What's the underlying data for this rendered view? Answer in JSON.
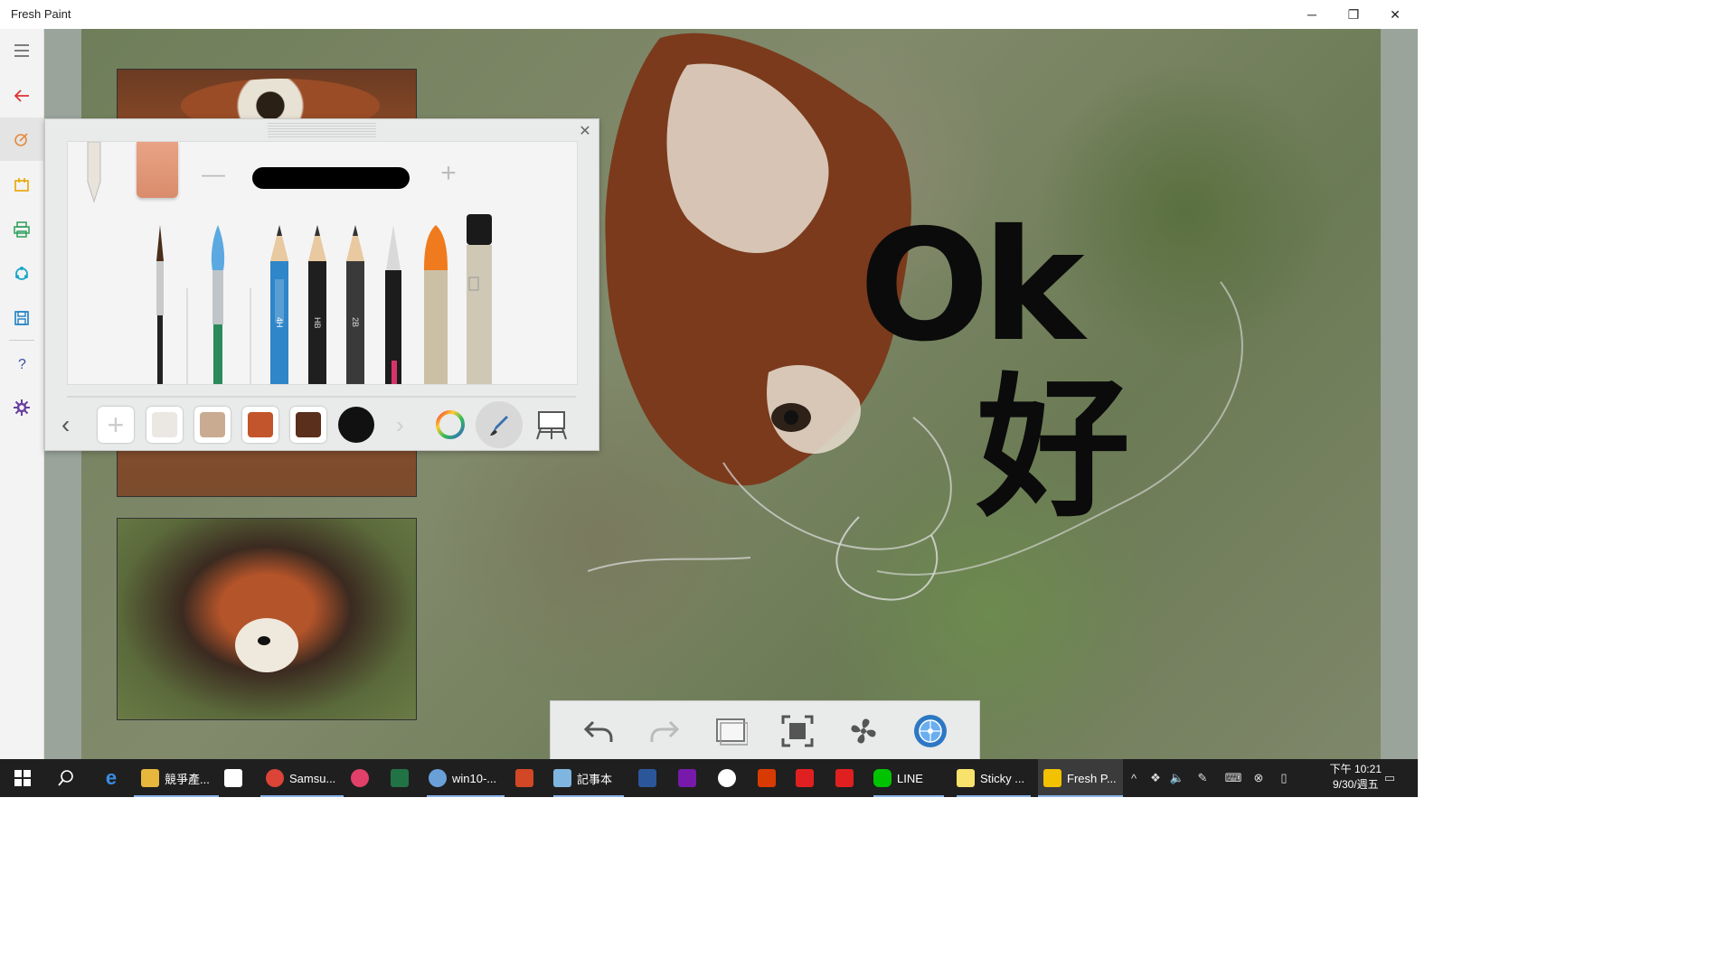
{
  "app": {
    "title": "Fresh Paint"
  },
  "window_controls": {
    "minimize": "─",
    "maximize": "❐",
    "close": "✕"
  },
  "left_rail": {
    "items": [
      {
        "name": "menu-icon"
      },
      {
        "name": "back-arrow-icon"
      },
      {
        "name": "brush-icon"
      },
      {
        "name": "import-icon"
      },
      {
        "name": "print-icon"
      },
      {
        "name": "share-icon"
      },
      {
        "name": "save-icon"
      },
      {
        "name": "help-icon"
      },
      {
        "name": "settings-icon"
      }
    ]
  },
  "canvas": {
    "text_1": "Ok",
    "text_2": "好"
  },
  "tool_panel": {
    "close": "✕",
    "size_minus": "—",
    "size_plus": "+",
    "tools": [
      "brush-fine",
      "brush-flat",
      "pencil-4H",
      "pencil-HB",
      "pencil-2B",
      "pen",
      "crayon",
      "marker"
    ],
    "pencil_labels": [
      "4H",
      "HB",
      "2B"
    ],
    "swatch_colors": [
      "#ebe8e3",
      "#c9ab92",
      "#c2552b",
      "#5a2f1b",
      "#111111"
    ],
    "add_color": "+",
    "prev": "‹",
    "next": "›"
  },
  "bottom_toolbar": {
    "items": [
      "undo-icon",
      "redo-icon",
      "layers-icon",
      "fit-screen-icon",
      "fan-dry-icon",
      "compass-icon"
    ]
  },
  "taskbar": {
    "apps": [
      {
        "label": "競爭產...",
        "color": "#e6b73c"
      },
      {
        "label": "",
        "color": "#ffffff"
      },
      {
        "label": "Samsu...",
        "color": "#db4437"
      },
      {
        "label": "",
        "color": "#e0406a"
      },
      {
        "label": "",
        "color": "#217346"
      },
      {
        "label": "win10-...",
        "color": "#6aa0d8"
      },
      {
        "label": "",
        "color": "#d24726"
      },
      {
        "label": "記事本",
        "color": "#7eb6e0"
      },
      {
        "label": "",
        "color": "#2b579a"
      },
      {
        "label": "",
        "color": "#7719aa"
      },
      {
        "label": "",
        "color": "#ffffff"
      },
      {
        "label": "",
        "color": "#d83b01"
      },
      {
        "label": "",
        "color": "#e02020"
      },
      {
        "label": "",
        "color": "#e02020"
      },
      {
        "label": "LINE",
        "color": "#00c300"
      },
      {
        "label": "Sticky ...",
        "color": "#f7e26b"
      },
      {
        "label": "Fresh P...",
        "color": "#f2c200"
      }
    ],
    "clock_time": "下午 10:21",
    "clock_date": "9/30/週五"
  }
}
